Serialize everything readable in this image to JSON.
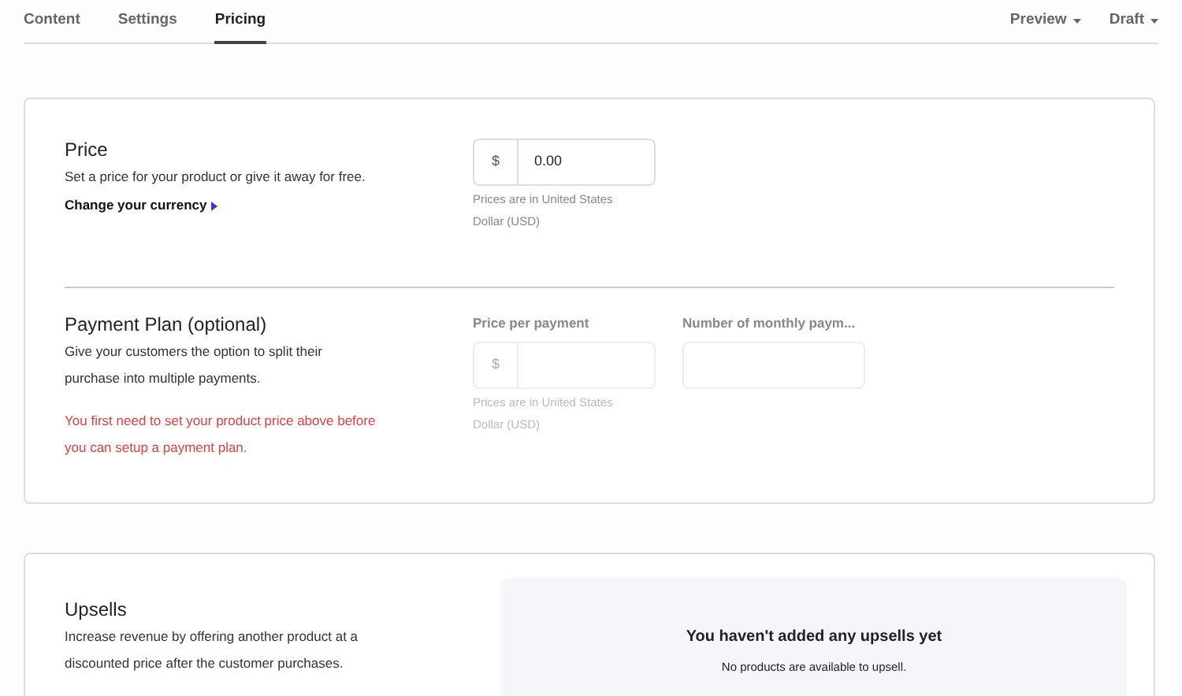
{
  "tabs": [
    {
      "label": "Content",
      "selected": false
    },
    {
      "label": "Settings",
      "selected": false
    },
    {
      "label": "Pricing",
      "selected": true
    }
  ],
  "menus": [
    "Preview",
    "Draft"
  ],
  "price": {
    "title": "Price",
    "description": "Set a price for your product or give it away for free.",
    "link": "Change your currency",
    "currency": "$",
    "value": "0.00",
    "hint": "Prices are in United States Dollar (USD)"
  },
  "payment_plan": {
    "title": "Payment Plan (optional)",
    "description": "Give your customers the option to split their purchase into multiple payments.",
    "warning": "You first need to set your product price above before you can setup a payment plan.",
    "fields": [
      {
        "label": "Price per payment",
        "currency": "$",
        "hint": "Prices are in United States Dollar (USD)",
        "disabled": true
      },
      {
        "label": "Number of monthly paym...",
        "disabled": true
      }
    ]
  },
  "upsells": {
    "title": "Upsells",
    "description": "Increase revenue by offering another product at a discounted price after the customer purchases.",
    "empty_title": "You haven't added any upsells yet",
    "empty_text": "No products are available to upsell."
  }
}
